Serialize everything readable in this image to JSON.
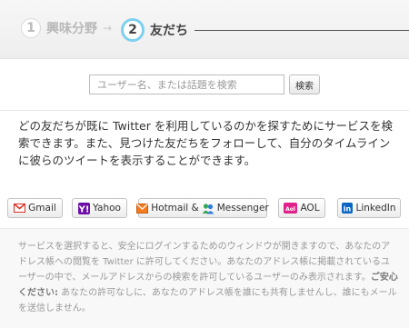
{
  "steps": [
    {
      "number": "1",
      "label": "興味分野"
    },
    {
      "number": "2",
      "label": "友だち"
    }
  ],
  "step_arrow": "→",
  "search": {
    "placeholder": "ユーザー名、または話題を検索",
    "button_label": "検索"
  },
  "description": "どの友だちが既に Twitter を利用しているのかを探すためにサービスを検索できます。また、見つけた友だちをフォローして、自分のタイムラインに彼らのツイートを表示することができます。",
  "services": {
    "gmail": {
      "label": "Gmail",
      "icon": "gmail-icon"
    },
    "yahoo": {
      "label": "Yahoo",
      "icon": "yahoo-icon"
    },
    "hotmail": {
      "label": "Hotmail &",
      "extra_label": "Messenger",
      "icon": "hotmail-icon",
      "extra_icon": "messenger-icon"
    },
    "aol": {
      "label": "AOL",
      "icon": "aol-icon"
    },
    "linkedin": {
      "label": "LinkedIn",
      "icon": "linkedin-icon"
    }
  },
  "notice": {
    "text_part1": "サービスを選択すると、安全にログインするためのウィンドウが開きますので、あなたのアドレス帳への閲覧を Twitter に許可してください。あなたのアドレス帳に掲載されているユーザーの中で、メールアドレスからの検索を許可しているユーザーのみ表示されます。",
    "strong": "ご安心ください:",
    "text_part2": " あなたの許可なしに、あなたのアドレス帳を誰にも共有しませんし、誰にもメールを送信しません。"
  },
  "colors": {
    "active_step_ring": "#7fd0ef",
    "gmail_red": "#d93025",
    "yahoo_purple": "#6b0fa8",
    "aol_pink": "#e0218a",
    "linkedin_blue": "#0a66c2",
    "hotmail_orange": "#f47b20"
  }
}
